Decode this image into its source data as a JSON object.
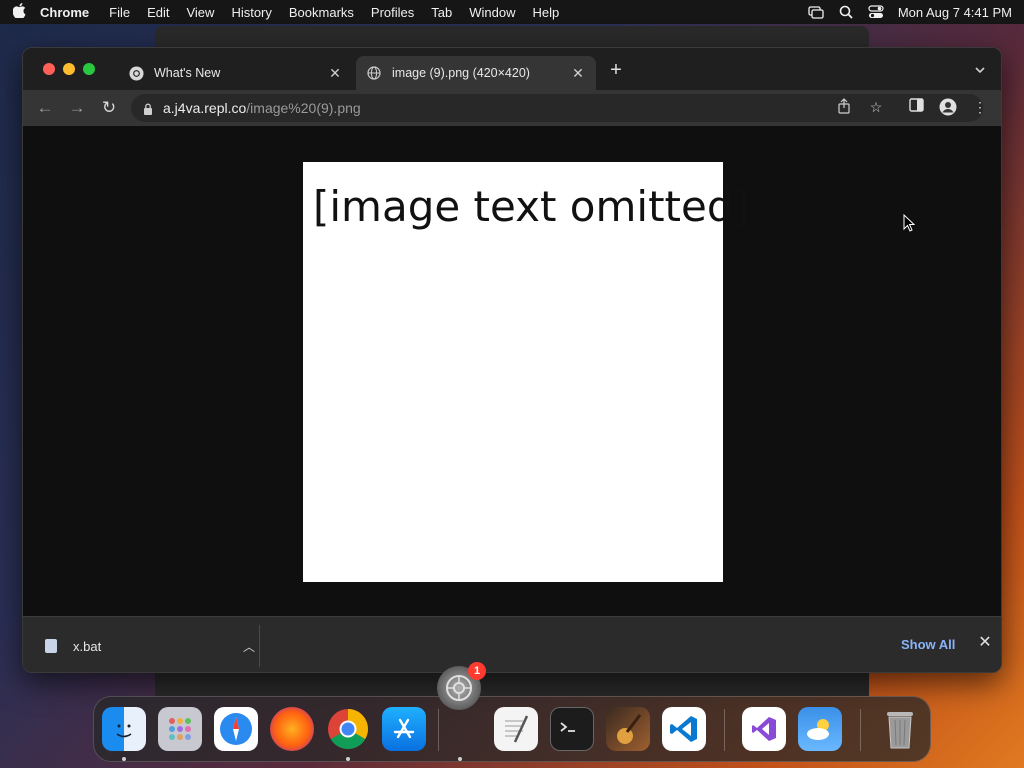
{
  "menubar": {
    "app_name": "Chrome",
    "items": [
      "File",
      "Edit",
      "View",
      "History",
      "Bookmarks",
      "Profiles",
      "Tab",
      "Window",
      "Help"
    ],
    "clock": "Mon Aug 7  4:41 PM"
  },
  "tabs": [
    {
      "title": "What's New",
      "favicon": "chrome-logo-icon"
    },
    {
      "title": "image (9).png (420×420)",
      "favicon": "globe-icon",
      "active": true
    }
  ],
  "toolbar": {
    "url_host": "a.j4va.repl.co",
    "url_path": "/image%20(9).png"
  },
  "viewer": {
    "lines": [
      "[image text omitted]"
    ]
  },
  "downloads": {
    "file_name": "x.bat",
    "show_all_label": "Show All"
  },
  "dock": {
    "apps": [
      "finder",
      "launchpad",
      "safari",
      "firefox",
      "chrome",
      "app-store",
      "textedit",
      "terminal",
      "garageband",
      "vscode",
      "visual-studio",
      "weather",
      "trash"
    ],
    "floating_icon": "system-settings-icon",
    "badge_count": "1"
  },
  "colors": {
    "accent_link": "#8ab4f8",
    "traffic_close": "#ff5f57",
    "traffic_min": "#febc2e",
    "traffic_max": "#28c840",
    "badge": "#ff3b30"
  }
}
